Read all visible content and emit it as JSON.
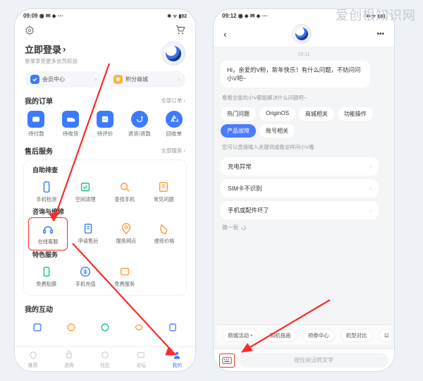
{
  "watermark": "爱创根知识网",
  "phone1": {
    "status": {
      "time": "09:09",
      "icons_left": "◉ ✉ ⬥ ⋯",
      "icons_right": "✱ ᯤ ▮82"
    },
    "login_title": "立即登录",
    "login_sub": "登录享受更多会员权益",
    "pills": [
      {
        "label": "会员中心",
        "chevron": "›"
      },
      {
        "label": "积分商城",
        "chevron": "›"
      }
    ],
    "orders": {
      "title": "我的订单",
      "more": "全部订单 ›",
      "items": [
        {
          "label": "待付款",
          "color": "#3c7bff"
        },
        {
          "label": "待收货",
          "color": "#3c7bff"
        },
        {
          "label": "待评价",
          "color": "#3c7bff"
        },
        {
          "label": "退货/退款",
          "color": "#3c7bff"
        },
        {
          "label": "回收单",
          "color": "#3c7bff"
        }
      ]
    },
    "service": {
      "title": "售后服务",
      "more": "全部服务 ›",
      "self": {
        "sub": "自助排查",
        "items": [
          {
            "label": "手机检测",
            "color": "#3c7bff"
          },
          {
            "label": "空间清理",
            "color": "#15c27a"
          },
          {
            "label": "查找手机",
            "color": "#ff9b3a"
          },
          {
            "label": "常见问题",
            "color": "#ff9b3a"
          }
        ]
      },
      "consult": {
        "sub": "咨询与维修",
        "items": [
          {
            "label": "在线客服",
            "color": "#3c7bff"
          },
          {
            "label": "申请售后",
            "color": "#3c7bff"
          },
          {
            "label": "服务网点",
            "color": "#ff9b3a"
          },
          {
            "label": "维修价格",
            "color": "#ff9b3a"
          }
        ]
      },
      "special": {
        "sub": "特色服务",
        "items": [
          {
            "label": "免费贴膜",
            "color": "#15c27a"
          },
          {
            "label": "手机充值",
            "color": "#3c7bff"
          },
          {
            "label": "免费服务",
            "color": "#ff9b3a"
          }
        ]
      }
    },
    "interact": {
      "title": "我的互动",
      "icon_colors": [
        "#3c7bff",
        "#ff9b3a",
        "#15c27a",
        "#ff9b3a",
        "#3c7bff"
      ]
    },
    "tabs": [
      {
        "label": "推荐"
      },
      {
        "label": "选购"
      },
      {
        "label": "社区"
      },
      {
        "label": "论坛"
      },
      {
        "label": "我的"
      }
    ]
  },
  "phone2": {
    "status": {
      "time": "09:12",
      "icons_left": "◉ ⬥ ✉ ⬥ ⋯",
      "icons_right": "✱ ᯤ ▮81"
    },
    "more": "•••",
    "timestamp": "09:11",
    "greeting": "Hi，亲爱的V粉，新年快乐！有什么问题，不妨问问小V吧~",
    "skills_hint": "看看全能的小V都能解决什么问题吧~",
    "chips": [
      "热门问题",
      "OriginOS",
      "商城相关",
      "功能操作",
      "产品故障",
      "账号相关"
    ],
    "active_chip_index": 4,
    "kw_hint": "您可以直接输入关键词或像这样问小V喔",
    "questions": [
      "充电异常",
      "SIM卡不识别",
      "手机或配件坏了"
    ],
    "refresh": "换一批",
    "quick": [
      "商城活动",
      "购机指南",
      "领券中心",
      "机型对比",
      "以"
    ],
    "input_placeholder": "按住说话转文字"
  }
}
